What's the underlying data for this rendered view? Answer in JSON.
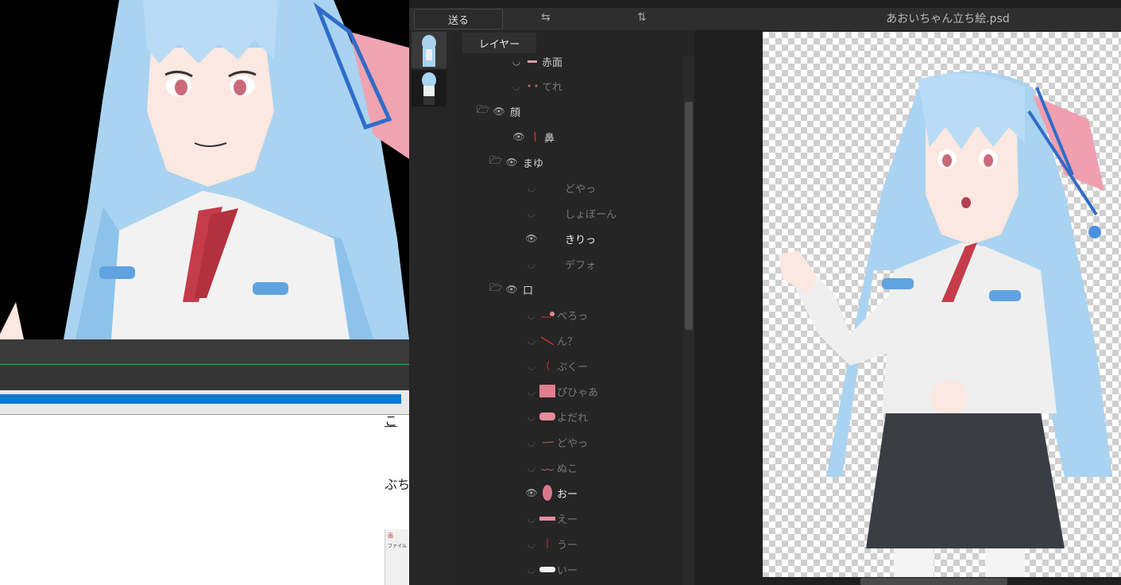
{
  "toolbar": {
    "send_label": "送る",
    "swap_horizontal_icon": "⇆",
    "swap_vertical_icon": "⇅"
  },
  "file_title": "あおいちゃん立ち絵.psd",
  "tooltip": "レイヤー",
  "layers": [
    {
      "label": "赤面",
      "visible": false,
      "dim": true
    },
    {
      "label": "てれ",
      "visible": false,
      "dim": true
    },
    {
      "label": "顔",
      "visible": true,
      "folder": true
    },
    {
      "label": "鼻",
      "visible": true
    },
    {
      "label": "まゆ",
      "visible": true,
      "folder": true
    },
    {
      "label": "どやっ",
      "visible": false,
      "dim": true
    },
    {
      "label": "しょぼーん",
      "visible": false,
      "dim": true
    },
    {
      "label": "きりっ",
      "visible": true
    },
    {
      "label": "デフォ",
      "visible": false,
      "dim": true
    },
    {
      "label": "口",
      "visible": true,
      "folder": true
    },
    {
      "label": "ぺろっ",
      "visible": false,
      "dim": true
    },
    {
      "label": "ん？",
      "visible": false,
      "dim": true
    },
    {
      "label": "ぷくー",
      "visible": false,
      "dim": true
    },
    {
      "label": "ぴひゃあ",
      "visible": false,
      "dim": true
    },
    {
      "label": "よだれ",
      "visible": false,
      "dim": true
    },
    {
      "label": "どやっ",
      "visible": false,
      "dim": true
    },
    {
      "label": "ぬこ",
      "visible": false,
      "dim": true
    },
    {
      "label": "おー",
      "visible": true
    },
    {
      "label": "えー",
      "visible": false,
      "dim": true
    },
    {
      "label": "うー",
      "visible": false,
      "dim": true
    },
    {
      "label": "いー",
      "visible": false,
      "dim": true
    }
  ],
  "doc": {
    "link_text": "こ",
    "body_text": "ぶち",
    "thumb_label1": "画",
    "thumb_label2": "ファイル"
  }
}
